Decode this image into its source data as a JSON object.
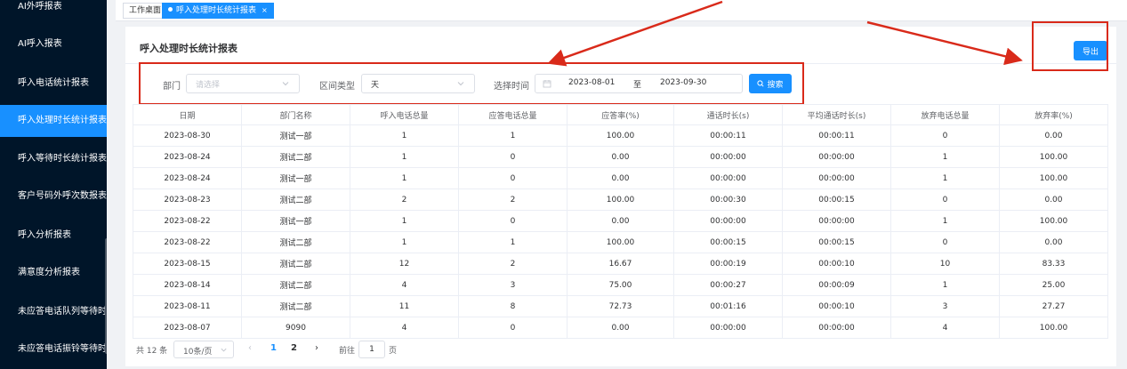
{
  "sidebar": {
    "items": [
      {
        "label": "AI外呼报表"
      },
      {
        "label": "AI呼入报表"
      },
      {
        "label": "呼入电话统计报表"
      },
      {
        "label": "呼入处理时长统计报表"
      },
      {
        "label": "呼入等待时长统计报表"
      },
      {
        "label": "客户号码外呼次数报表"
      },
      {
        "label": "呼入分析报表"
      },
      {
        "label": "满意度分析报表"
      },
      {
        "label": "未应答电话队列等待时长"
      },
      {
        "label": "未应答电话振铃等待时长"
      }
    ],
    "active_index": 3
  },
  "tabs": [
    {
      "label": "工作桌面",
      "active": false
    },
    {
      "label": "呼入处理时长统计报表",
      "active": true,
      "close": "×"
    }
  ],
  "page": {
    "title": "呼入处理时长统计报表",
    "export_label": "导出"
  },
  "filters": {
    "dept_label": "部门",
    "dept_placeholder": "请选择",
    "interval_label": "区间类型",
    "interval_value": "天",
    "time_label": "选择时间",
    "date_start": "2023-08-01",
    "date_sep": "至",
    "date_end": "2023-09-30",
    "search_label": "搜索"
  },
  "table": {
    "headers": [
      "日期",
      "部门名称",
      "呼入电话总量",
      "应答电话总量",
      "应答率(%)",
      "通话时长(s)",
      "平均通话时长(s)",
      "放弃电话总量",
      "放弃率(%)"
    ],
    "rows": [
      [
        "2023-08-30",
        "测试一部",
        "1",
        "1",
        "100.00",
        "00:00:11",
        "00:00:11",
        "0",
        "0.00"
      ],
      [
        "2023-08-24",
        "测试二部",
        "1",
        "0",
        "0.00",
        "00:00:00",
        "00:00:00",
        "1",
        "100.00"
      ],
      [
        "2023-08-24",
        "测试一部",
        "1",
        "0",
        "0.00",
        "00:00:00",
        "00:00:00",
        "1",
        "100.00"
      ],
      [
        "2023-08-23",
        "测试二部",
        "2",
        "2",
        "100.00",
        "00:00:30",
        "00:00:15",
        "0",
        "0.00"
      ],
      [
        "2023-08-22",
        "测试一部",
        "1",
        "0",
        "0.00",
        "00:00:00",
        "00:00:00",
        "1",
        "100.00"
      ],
      [
        "2023-08-22",
        "测试二部",
        "1",
        "1",
        "100.00",
        "00:00:15",
        "00:00:15",
        "0",
        "0.00"
      ],
      [
        "2023-08-15",
        "测试二部",
        "12",
        "2",
        "16.67",
        "00:00:19",
        "00:00:10",
        "10",
        "83.33"
      ],
      [
        "2023-08-14",
        "测试二部",
        "4",
        "3",
        "75.00",
        "00:00:27",
        "00:00:09",
        "1",
        "25.00"
      ],
      [
        "2023-08-11",
        "测试二部",
        "11",
        "8",
        "72.73",
        "00:01:16",
        "00:00:10",
        "3",
        "27.27"
      ],
      [
        "2023-08-07",
        "9090",
        "4",
        "0",
        "0.00",
        "00:00:00",
        "00:00:00",
        "4",
        "100.00"
      ]
    ]
  },
  "pagination": {
    "total": "共 12 条",
    "page_size": "10条/页",
    "prev": "‹",
    "pages": [
      "1",
      "2"
    ],
    "current": "1",
    "next": "›",
    "goto_label": "前往",
    "goto_value": "1",
    "page_suffix": "页"
  },
  "colors": {
    "sidebar_bg": "#001529",
    "primary": "#1890ff",
    "annotation": "#d92a1a"
  }
}
